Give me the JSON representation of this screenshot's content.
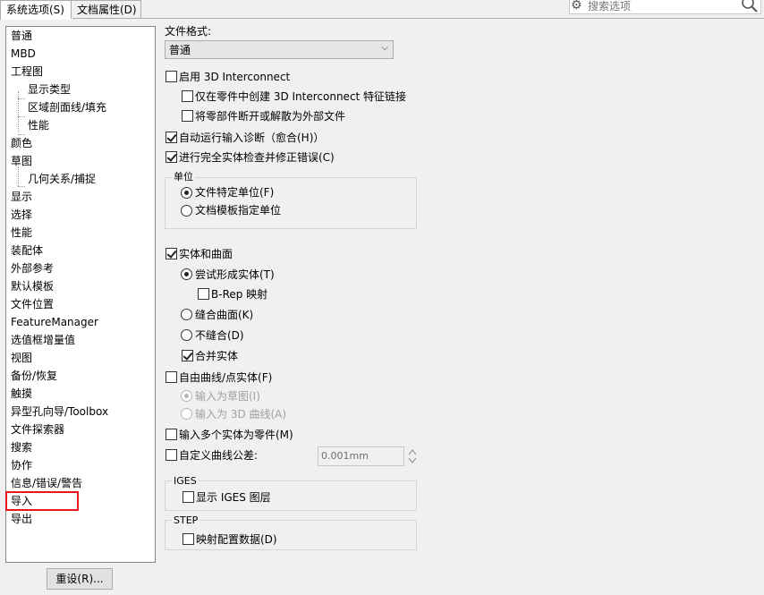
{
  "tabs": [
    {
      "label": "系统选项(S)",
      "active": true
    },
    {
      "label": "文档属性(D)",
      "active": false
    }
  ],
  "search": {
    "placeholder": "搜索选项"
  },
  "tree": {
    "items": [
      "普通",
      "MBD",
      "工程图",
      "显示类型",
      "区域剖面线/填充",
      "性能",
      "颜色",
      "草图",
      "几何关系/捕捉",
      "显示",
      "选择",
      "性能",
      "装配体",
      "外部参考",
      "默认模板",
      "文件位置",
      "FeatureManager",
      "选值框增量值",
      "视图",
      "备份/恢复",
      "触摸",
      "异型孔向导/Toolbox",
      "文件探索器",
      "搜索",
      "协作",
      "信息/错误/警告",
      "导入",
      "导出"
    ],
    "selected": "导入"
  },
  "reset_button": "重设(R)...",
  "file_format": {
    "label": "文件格式:",
    "value": "普通"
  },
  "options": {
    "enable_3di": "启用 3D Interconnect",
    "create_link": "仅在零件中创建 3D Interconnect 特征链接",
    "break_link": "将零部件断开或解散为外部文件",
    "auto_diag": "自动运行输入诊断（愈合(H)）",
    "full_check": "进行完全实体检查并修正错误(C)"
  },
  "units": {
    "title": "单位",
    "file_units": "文件特定单位(F)",
    "template_units": "文档模板指定单位"
  },
  "solids": {
    "label": "实体和曲面",
    "try_solid": "尝试形成实体(T)",
    "brep": "B-Rep 映射",
    "knit": "缝合曲面(K)",
    "no_knit": "不缝合(D)",
    "merge": "合并实体"
  },
  "free_curves": {
    "label": "自由曲线/点实体(F)",
    "as_sketch": "输入为草图(I)",
    "as_3d": "输入为 3D 曲线(A)"
  },
  "multi_body": "输入多个实体为零件(M)",
  "custom_tol": {
    "label": "自定义曲线公差:",
    "value": "0.001mm"
  },
  "iges": {
    "title": "IGES",
    "show_layers": "显示 IGES 图层"
  },
  "step": {
    "title": "STEP",
    "map_config": "映射配置数据(D)"
  }
}
